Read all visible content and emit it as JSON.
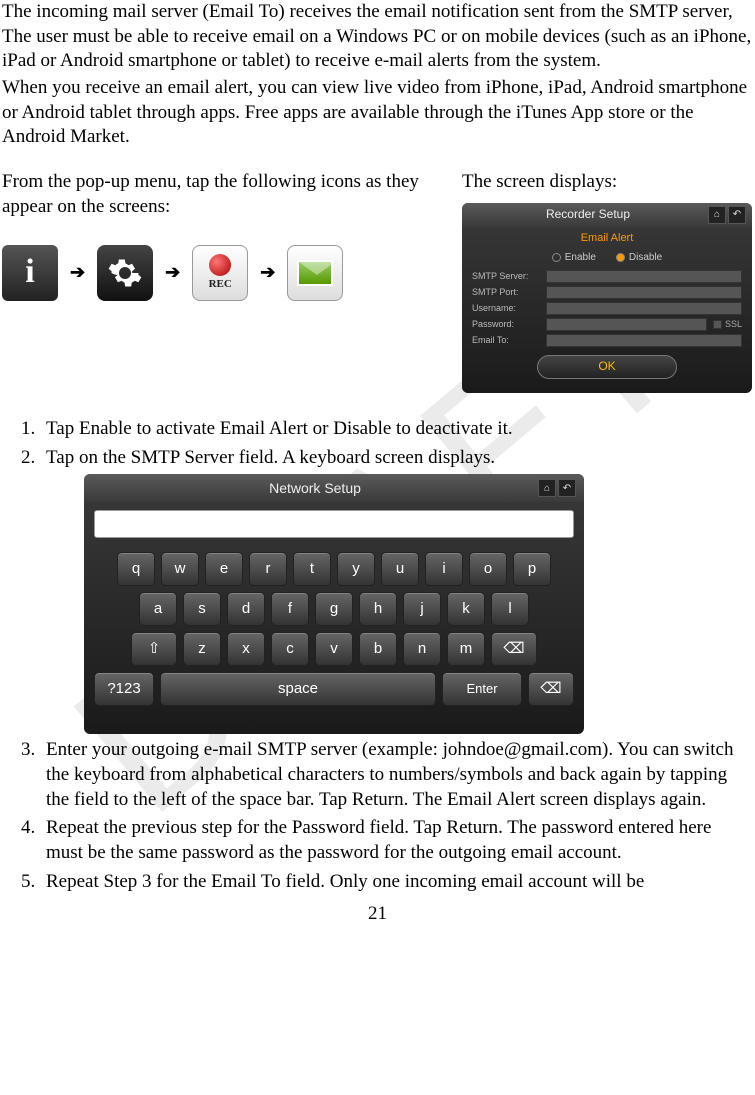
{
  "watermark": "DRAFT",
  "intro": {
    "p1": "The incoming mail server (Email To) receives the email notification sent from the SMTP server, The user must be able to receive email on a Windows PC or on mobile devices (such as an iPhone, iPad or Android smartphone or tablet) to receive e-mail alerts from the system.",
    "p2": "When you receive an email alert, you can view live video from iPhone, iPad, Android smartphone or Android tablet through apps. Free apps are available through the iTunes App store or the Android Market."
  },
  "columns": {
    "left_text": "From the pop-up menu, tap the following icons as they appear on the screens:",
    "right_text": "The screen displays:"
  },
  "icons": {
    "arrow": "➔",
    "info_glyph": "i",
    "rec_label": "REC"
  },
  "recorder": {
    "title": "Recorder Setup",
    "alert": "Email Alert",
    "enable": "Enable",
    "disable": "Disable",
    "fields": {
      "smtp_server": "SMTP Server:",
      "smtp_port": "SMTP Port:",
      "username": "Username:",
      "password": "Password:",
      "email_to": "Email To:"
    },
    "ssl": "SSL",
    "ok": "OK"
  },
  "keyboard": {
    "title": "Network Setup",
    "rows": {
      "r1": [
        "q",
        "w",
        "e",
        "r",
        "t",
        "y",
        "u",
        "i",
        "o",
        "p"
      ],
      "r2": [
        "a",
        "s",
        "d",
        "f",
        "g",
        "h",
        "j",
        "k",
        "l"
      ],
      "r3": [
        "z",
        "x",
        "c",
        "v",
        "b",
        "n",
        "m"
      ],
      "shift": "⇧",
      "sym": "?123",
      "space": "space",
      "enter": "Enter",
      "bksp": "⌫"
    }
  },
  "steps": {
    "s1": "Tap Enable to activate Email Alert or Disable to deactivate it.",
    "s2": "Tap on the SMTP Server field. A keyboard screen displays.",
    "s3": "Enter your outgoing e-mail SMTP server (example: johndoe@gmail.com). You can switch the keyboard from alphabetical characters to numbers/symbols and back again by tapping the field to the left of the space bar. Tap Return. The Email Alert screen displays again.",
    "s4": "Repeat the previous step for the Password field. Tap Return. The password entered here must be the same password as the password for the outgoing email account.",
    "s5": "Repeat Step 3 for the Email To field. Only one incoming email account will be"
  },
  "page_number": "21"
}
